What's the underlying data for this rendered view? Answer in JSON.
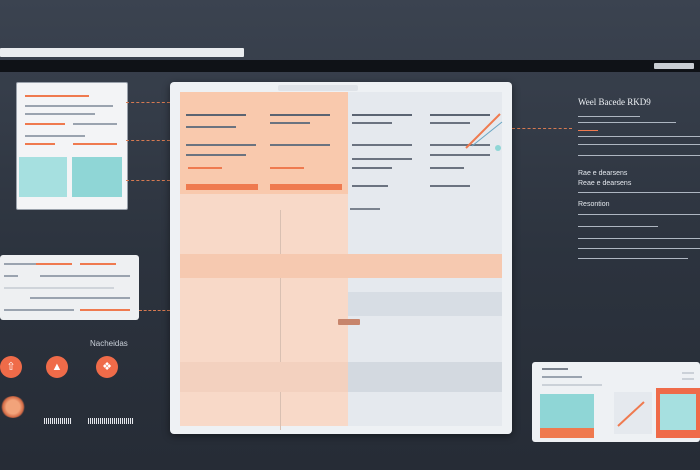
{
  "top_url_text": "",
  "menubar": {
    "right_label": ""
  },
  "left_window": {
    "caption": ""
  },
  "left_panel": {
    "caption": ""
  },
  "tools": {
    "label": "Nacheidas",
    "icons": [
      "arrow-icon",
      "flame-icon",
      "brand-icon"
    ]
  },
  "main_window": {
    "col1_header": "",
    "col1_row1": "",
    "col2_header": "",
    "center_badge": ""
  },
  "right_column": {
    "title": "Weel Bacede RKD9",
    "sub1": "Rae e dearsens",
    "sub1b": "Reae e dearsens",
    "sub2": "Resontion",
    "footer": ""
  },
  "colors": {
    "accent": "#ef6b49",
    "teal": "#a6e0e0",
    "salmon": "#f9c9ad",
    "background": "#2f3642"
  }
}
